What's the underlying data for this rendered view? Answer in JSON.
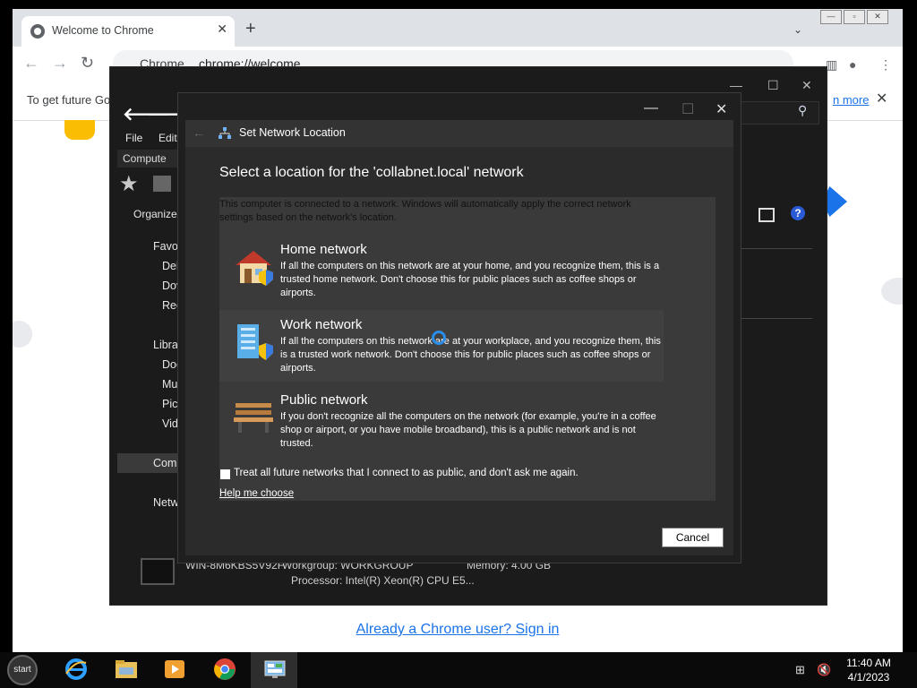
{
  "chrome": {
    "tab_title": "Welcome to Chrome",
    "tab_close": "✕",
    "new_tab": "+",
    "tab_menu": "⌄",
    "omnibox_label": "Chrome",
    "omnibox_url": "chrome://welcome",
    "infobar_text": "To get future Go",
    "infobar_link": "n more",
    "infobar_close": "✕",
    "signin_link": "Already a Chrome user? Sign in"
  },
  "explorer": {
    "back": "🡐",
    "forward": "🡒",
    "menu_file": "File",
    "menu_edit": "Edit",
    "crumb": "Compute",
    "organize": "Organize",
    "nav": [
      "Favo",
      "Del",
      "Dov",
      "Rec",
      "Libra",
      "Doc",
      "Mu",
      "Pic",
      "Vid",
      "Com",
      "Netw"
    ],
    "footer_computer": "WIN-8M6KBS5V92F",
    "footer_workgroup": "Workgroup:  WORKGROUP",
    "footer_memory": "Memory:  4.00 GB",
    "footer_processor": "Processor:  Intel(R) Xeon(R) CPU E5..."
  },
  "dialog": {
    "title": "Set Network Location",
    "heading": "Select a location for the 'collabnet.local' network",
    "description": "This computer is connected to a network. Windows will automatically apply the correct network settings based on the network's location.",
    "options": [
      {
        "name": "Home network",
        "text": "If all the computers on this network are at your home, and you recognize them, this is a trusted home network.  Don't choose this for public places such as coffee shops or airports.",
        "icon": "house-icon"
      },
      {
        "name": "Work network",
        "text": "If all the computers on this network are at your workplace, and you recognize them, this is a trusted work network.  Don't choose this for public places such as coffee shops or airports.",
        "icon": "office-building-icon"
      },
      {
        "name": "Public network",
        "text": "If you don't recognize all the computers on the network (for example, you're in a coffee shop or airport, or you have mobile broadband), this is a public network and is not trusted.",
        "icon": "park-bench-icon"
      }
    ],
    "checkbox_label": "Treat all future networks that I connect to as public, and don't ask me again.",
    "help_link": "Help me choose",
    "cancel": "Cancel"
  },
  "taskbar": {
    "start": "start",
    "time": "11:40 AM",
    "date": "4/1/2023"
  }
}
